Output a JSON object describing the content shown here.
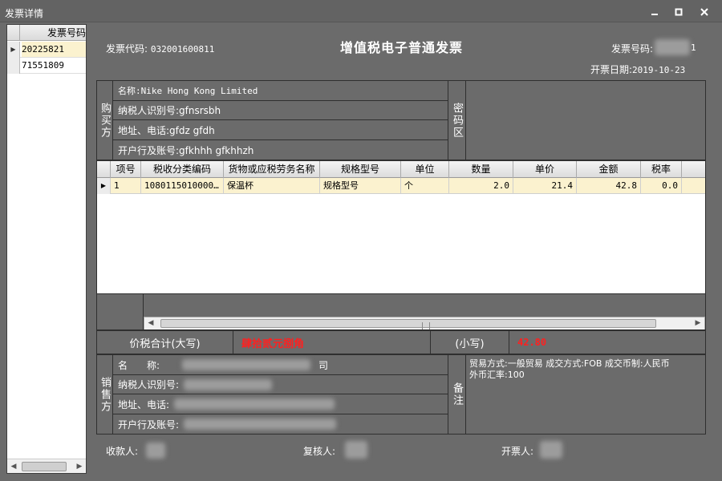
{
  "window": {
    "title": "发票详情",
    "minimize_icon": "minimize-icon",
    "maximize_icon": "maximize-icon",
    "close_icon": "close-icon"
  },
  "left_list": {
    "header": "发票号码",
    "rows": [
      "20225821",
      "71551809"
    ],
    "selected_index": 0
  },
  "invoice": {
    "code_label": "发票代码:",
    "code_value": "032001600811",
    "title": "增值税电子普通发票",
    "number_label": "发票号码:",
    "number_visible": "1",
    "date_label": "开票日期:",
    "date_value": "2019-10-23"
  },
  "buyer": {
    "section_label": "购买方",
    "name": "名称:Nike Hong Kong Limited",
    "tax_id": "纳税人识别号:gfnsrsbh",
    "address": "地址、电话:gfdz gfdh",
    "bank": "开户行及账号:gfkhhh gfkhhzh",
    "cipher_label": "密码区"
  },
  "items_table": {
    "columns": [
      "项号",
      "税收分类编码",
      "货物或应税劳务名称",
      "规格型号",
      "单位",
      "数量",
      "单价",
      "金额",
      "税率"
    ],
    "rows": [
      [
        "1",
        "1080115010000…",
        "保温杯",
        "规格型号",
        "个",
        "2.0",
        "21.4",
        "42.8",
        "0.0"
      ]
    ]
  },
  "totals": {
    "label_upper": "价税合计(大写)",
    "value_upper": "肆拾贰元捌角",
    "label_lower": "(小写)",
    "value_lower": "42.80"
  },
  "seller": {
    "section_label": "销售方",
    "name_label": "名　　称:",
    "name_suffix": "司",
    "tax_id_label": "纳税人识别号:",
    "address_label": "地址、电话:",
    "bank_label": "开户行及账号:",
    "remark_label": "备注",
    "remark_line1": "贸易方式:一般贸易 成交方式:FOB 成交币制:人民币",
    "remark_line2": "外币汇率:100"
  },
  "signers": {
    "payee_label": "收款人:",
    "reviewer_label": "复核人:",
    "issuer_label": "开票人:"
  }
}
